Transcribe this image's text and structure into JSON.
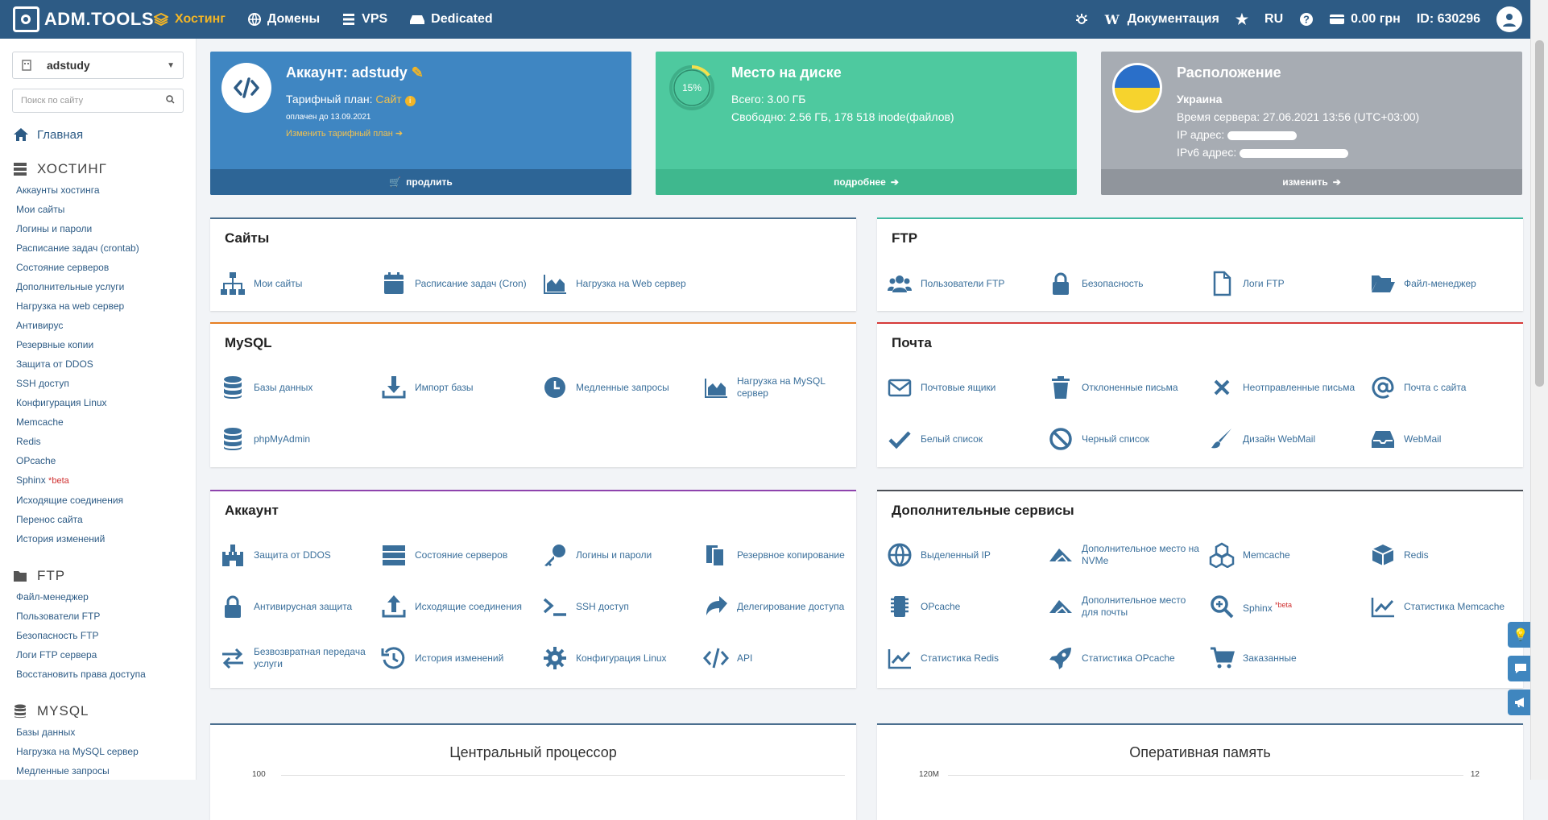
{
  "topbar": {
    "logo": "ADM.TOOLS",
    "nav": [
      {
        "label": "Хостинг",
        "icon": "stack-icon"
      },
      {
        "label": "Домены",
        "icon": "globe-icon"
      },
      {
        "label": "VPS",
        "icon": "server-icon"
      },
      {
        "label": "Dedicated",
        "icon": "hdd-icon"
      }
    ],
    "docs": "Документация",
    "lang": "RU",
    "balance": "0.00 грн",
    "id": "ID: 630296"
  },
  "sidebar": {
    "account": "adstudy",
    "search_placeholder": "Поиск по сайту",
    "home": "Главная",
    "hosting": {
      "title": "ХОСТИНГ",
      "links": [
        "Аккаунты хостинга",
        "Мои сайты",
        "Логины и пароли",
        "Расписание задач (crontab)",
        "Состояние серверов",
        "Дополнительные услуги",
        "Нагрузка на web сервер",
        "Антивирус",
        "Резервные копии",
        "Защита от DDOS",
        "SSH доступ",
        "Конфигурация Linux",
        "Memcache",
        "Redis",
        "OPcache",
        "Sphinx",
        "Исходящие соединения",
        "Перенос сайта",
        "История изменений"
      ],
      "beta": "*beta"
    },
    "ftp": {
      "title": "FTP",
      "links": [
        "Файл-менеджер",
        "Пользователи FTP",
        "Безопасность FTP",
        "Логи FTP сервера",
        "Восстановить права доступа"
      ]
    },
    "mysql": {
      "title": "MYSQL",
      "links": [
        "Базы данных",
        "Нагрузка на MySQL сервер",
        "Медленные запросы"
      ]
    }
  },
  "account_card": {
    "title": "Аккаунт: adstudy",
    "plan_label": "Тарифный план:",
    "plan": "Сайт",
    "paid": "оплачен до 13.09.2021",
    "change": "Изменить тарифный план",
    "footer": "продлить"
  },
  "disk_card": {
    "title": "Место на диске",
    "percent": "15%",
    "percent_value": 0.15,
    "total": "Всего: 3.00 ГБ",
    "free": "Свободно: 2.56 ГБ, 178 518 inode(файлов)",
    "footer": "подробнее"
  },
  "location_card": {
    "title": "Расположение",
    "country": "Украина",
    "time": "Время сервера: 27.06.2021 13:56 (UTC+03:00)",
    "ip": "IP адрес:",
    "ipv6": "IPv6 адрес:",
    "footer": "изменить"
  },
  "panels": {
    "sites": {
      "title": "Сайты",
      "items": [
        "Мои сайты",
        "Расписание задач (Cron)",
        "Нагрузка на Web сервер"
      ]
    },
    "ftp": {
      "title": "FTP",
      "items": [
        "Пользователи FTP",
        "Безопасность",
        "Логи FTP",
        "Файл-менеджер"
      ]
    },
    "mysql": {
      "title": "MySQL",
      "items": [
        "Базы данных",
        "Импорт базы",
        "Медленные запросы",
        "Нагрузка на MySQL сервер",
        "phpMyAdmin"
      ]
    },
    "mail": {
      "title": "Почта",
      "items": [
        "Почтовые ящики",
        "Отклоненные письма",
        "Неотправленные письма",
        "Почта с сайта",
        "Белый список",
        "Черный список",
        "Дизайн WebMail",
        "WebMail"
      ]
    },
    "account": {
      "title": "Аккаунт",
      "items": [
        "Защита от DDOS",
        "Состояние серверов",
        "Логины и пароли",
        "Резервное копирование",
        "Антивирусная защита",
        "Исходящие соединения",
        "SSH доступ",
        "Делегирование доступа",
        "Безвозвратная передача услуги",
        "История изменений",
        "Конфигурация Linux",
        "API"
      ]
    },
    "extra": {
      "title": "Дополнительные сервисы",
      "items": [
        "Выделенный IP",
        "Дополнительное место на NVMe",
        "Memcache",
        "Redis",
        "OPcache",
        "Дополнительное место для почты",
        "Sphinx",
        "Статистика Memcache",
        "Статистика Redis",
        "Статистика OPcache",
        "Заказанные"
      ],
      "beta": "*beta"
    },
    "cpu": {
      "title": "Центральный процессор",
      "axis": "100"
    },
    "ram": {
      "title": "Оперативная память",
      "axis_left": "120M",
      "axis_right": "12"
    }
  }
}
